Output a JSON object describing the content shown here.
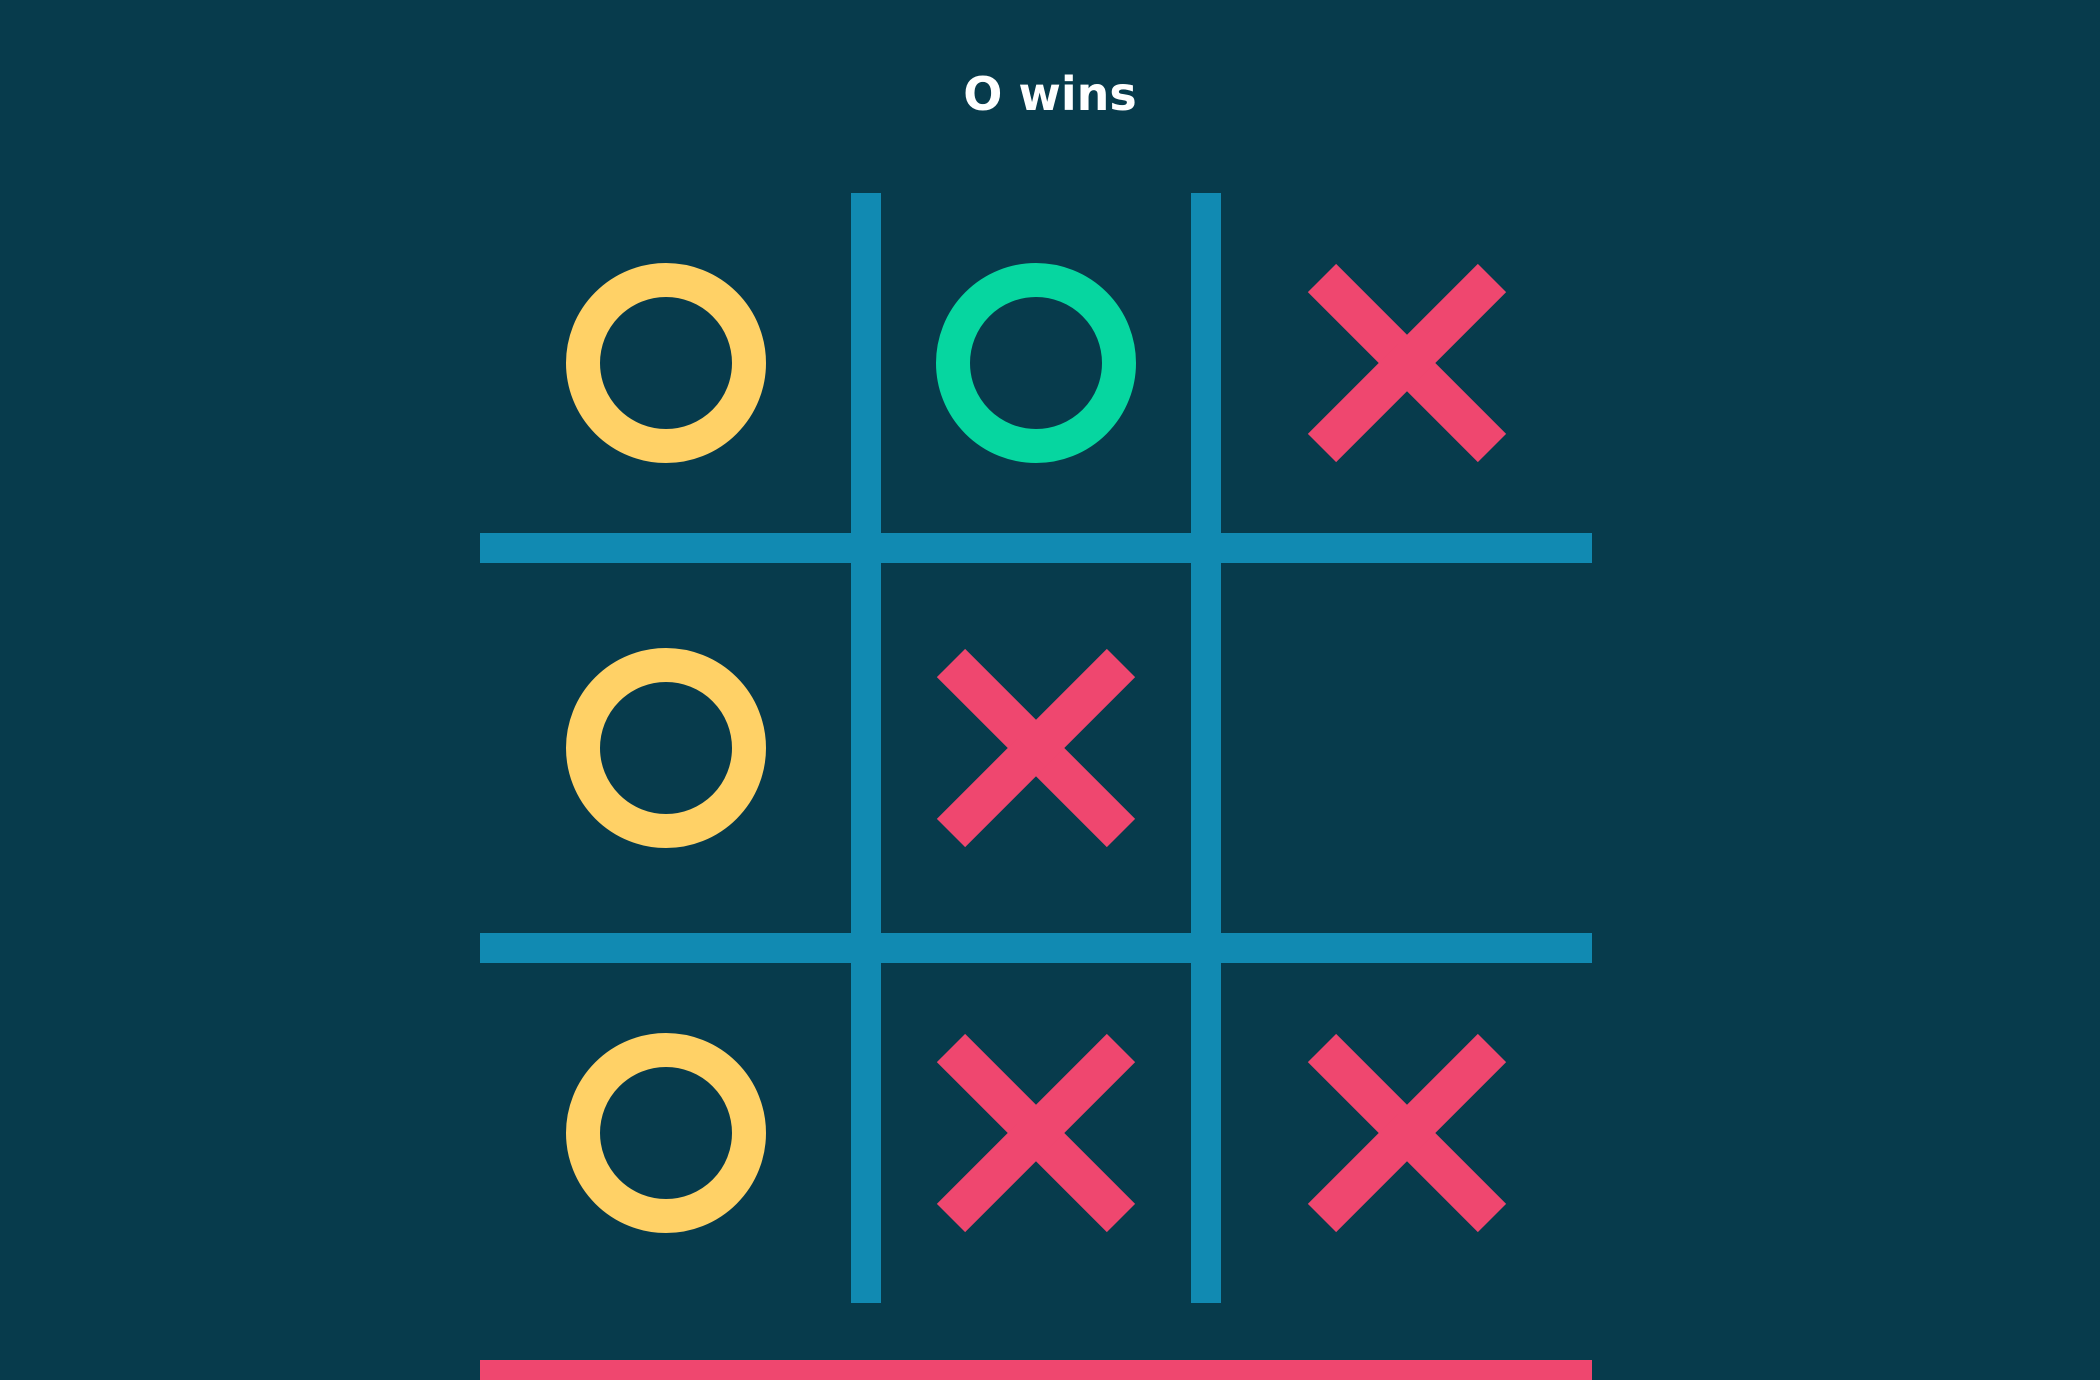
{
  "status": {
    "text": "O wins"
  },
  "board": {
    "cells": [
      {
        "mark": "O",
        "win": false
      },
      {
        "mark": "O",
        "win": true
      },
      {
        "mark": "X",
        "win": false
      },
      {
        "mark": "O",
        "win": false
      },
      {
        "mark": "X",
        "win": false
      },
      {
        "mark": "",
        "win": false
      },
      {
        "mark": "O",
        "win": false
      },
      {
        "mark": "X",
        "win": false
      },
      {
        "mark": "X",
        "win": false
      }
    ]
  },
  "colors": {
    "background": "#073b4c",
    "grid": "#118ab2",
    "o_mark": "#ffd166",
    "o_win_mark": "#06d6a0",
    "x_mark": "#ef476f",
    "status_text": "#ffffff",
    "reset_bar": "#ef476f"
  },
  "icons": {
    "o_mark": "circle-o-icon",
    "x_mark": "cross-x-icon"
  }
}
